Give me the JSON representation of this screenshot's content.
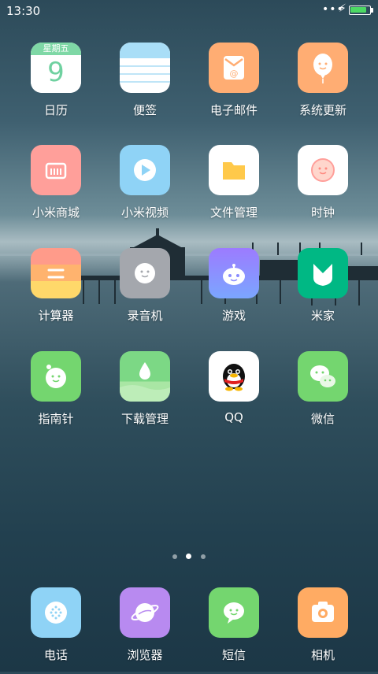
{
  "status_bar": {
    "time": "13:30",
    "signal": "•••",
    "charging": "⚡",
    "battery_level_percent": 85
  },
  "calendar": {
    "weekday": "星期五",
    "day": "9"
  },
  "apps": [
    {
      "label": "日历",
      "icon": "calendar-icon"
    },
    {
      "label": "便签",
      "icon": "notes-icon"
    },
    {
      "label": "电子邮件",
      "icon": "email-icon"
    },
    {
      "label": "系统更新",
      "icon": "system-update-icon"
    },
    {
      "label": "小米商城",
      "icon": "mi-store-icon"
    },
    {
      "label": "小米视频",
      "icon": "mi-video-icon"
    },
    {
      "label": "文件管理",
      "icon": "file-manager-icon"
    },
    {
      "label": "时钟",
      "icon": "clock-icon"
    },
    {
      "label": "计算器",
      "icon": "calculator-icon"
    },
    {
      "label": "录音机",
      "icon": "recorder-icon"
    },
    {
      "label": "游戏",
      "icon": "games-icon"
    },
    {
      "label": "米家",
      "icon": "mijia-icon"
    },
    {
      "label": "指南针",
      "icon": "compass-icon"
    },
    {
      "label": "下载管理",
      "icon": "download-manager-icon"
    },
    {
      "label": "QQ",
      "icon": "qq-icon"
    },
    {
      "label": "微信",
      "icon": "wechat-icon"
    }
  ],
  "pager": {
    "pages": 3,
    "current": 2
  },
  "dock": [
    {
      "label": "电话",
      "icon": "phone-icon"
    },
    {
      "label": "浏览器",
      "icon": "browser-icon"
    },
    {
      "label": "短信",
      "icon": "messages-icon"
    },
    {
      "label": "相机",
      "icon": "camera-icon"
    }
  ],
  "colors": {
    "calendar_green": "#7fd8a6",
    "notes_blue": "#a9def7",
    "email_orange": "#ffad73",
    "store_pink": "#ff9f9a",
    "video_blue": "#8fd3f6",
    "calc_yellow": "#ffd86a",
    "recorder_gray": "#a4a7ad",
    "games_purple": "#8a8cff",
    "mijia_green": "#00b884",
    "compass_green": "#74d66f",
    "browser_purple": "#b88af0",
    "camera_orange": "#ffab63"
  }
}
